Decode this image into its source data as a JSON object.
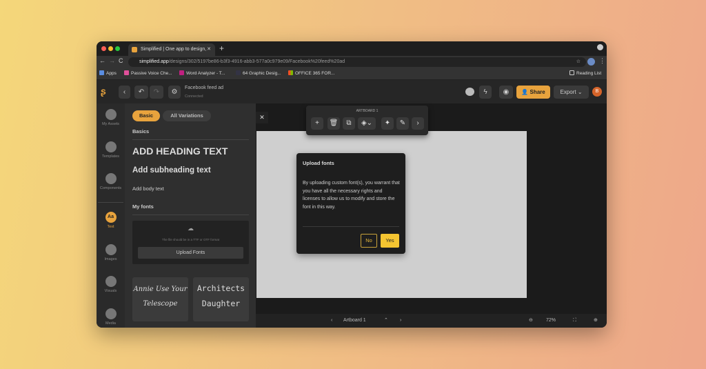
{
  "browser": {
    "tab_title": "Simplified | One app to design,",
    "url_host": "simplified.app",
    "url_path": "/designs/302/5197be86-b3f3-4916-abb3-577a0c979e09/Facebook%20feed%20ad",
    "bookmarks": [
      "Apps",
      "Passive Voice Che...",
      "Word Analyzer - T...",
      "64 Graphic Desig...",
      "OFFICE 365 FOR..."
    ],
    "reading_list": "Reading List"
  },
  "header": {
    "doc_title": "Facebook feed ad",
    "status": "Connected",
    "share": "Share",
    "export": "Export",
    "avatar": "B",
    "accent": "#e8a33d"
  },
  "rail": [
    {
      "label": "My Assets"
    },
    {
      "label": "Templates"
    },
    {
      "label": "Components"
    },
    {
      "label": "Text"
    },
    {
      "label": "Images"
    },
    {
      "label": "Visuals"
    },
    {
      "label": "Media"
    }
  ],
  "panel": {
    "tabs": [
      "Basic",
      "All Variations"
    ],
    "basics": "Basics",
    "heading": "ADD HEADING TEXT",
    "subheading": "Add subheading text",
    "body": "Add body text",
    "my_fonts": "My fonts",
    "upload_hint": "The file should be in a TTF or OTF format",
    "upload_button": "Upload Fonts",
    "font_cards": [
      "Annie Use Your Telescope",
      "Architects Daughter"
    ]
  },
  "toolbar": {
    "title": "ARTBOARD 1"
  },
  "modal": {
    "title": "Upload fonts",
    "body": "By uploading custom font(s), you warrant that you have all the necessary rights and licenses to allow us to modify and store the font in this way.",
    "no": "No",
    "yes": "Yes",
    "yes_color": "#f5c531"
  },
  "bottom": {
    "artboard": "Artboard 1",
    "zoom": "72%"
  }
}
